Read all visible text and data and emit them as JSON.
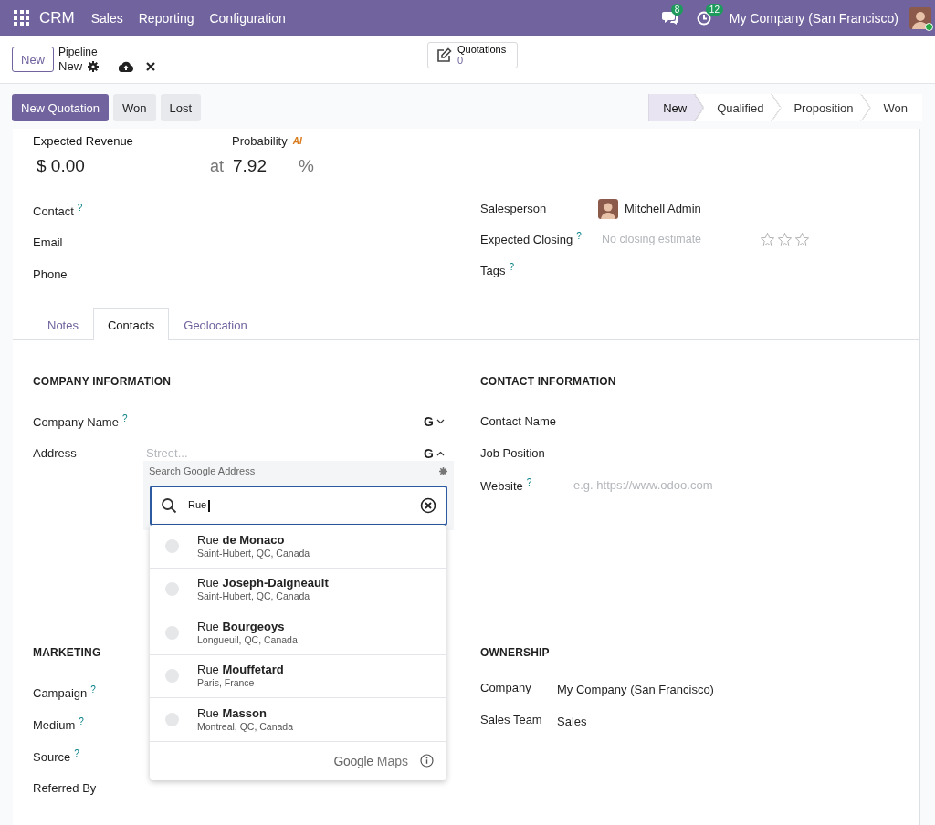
{
  "navbar": {
    "app": "CRM",
    "menus": [
      "Sales",
      "Reporting",
      "Configuration"
    ],
    "messages_count": "8",
    "activities_count": "12",
    "company": "My Company (San Francisco)"
  },
  "control_panel": {
    "new_button": "New",
    "breadcrumb": "Pipeline",
    "record": "New",
    "smart_button": {
      "label": "Quotations",
      "value": "0"
    }
  },
  "actions": [
    {
      "label": "New Quotation",
      "kind": "primary"
    },
    {
      "label": "Won",
      "kind": "secondary"
    },
    {
      "label": "Lost",
      "kind": "secondary"
    }
  ],
  "stages": [
    {
      "label": "New",
      "selected": true
    },
    {
      "label": "Qualified",
      "selected": false
    },
    {
      "label": "Proposition",
      "selected": false
    },
    {
      "label": "Won",
      "selected": false
    }
  ],
  "summary": {
    "revenue_label": "Expected Revenue",
    "revenue": "$ 0.00",
    "probability_label": "Probability",
    "ai_badge": "AI",
    "at": "at",
    "probability": "7.92",
    "percent": "%"
  },
  "left_fields": [
    {
      "label": "Contact",
      "help": "?"
    },
    {
      "label": "Email"
    },
    {
      "label": "Phone"
    }
  ],
  "right_fields": [
    {
      "label": "Salesperson",
      "kind": "user",
      "value": "Mitchell Admin"
    },
    {
      "label": "Expected Closing",
      "help": "?",
      "kind": "date",
      "placeholder": "No closing estimate",
      "stars": 0
    },
    {
      "label": "Tags",
      "help": "?",
      "kind": "plain"
    }
  ],
  "tabs": [
    {
      "label": "Notes",
      "selected": false
    },
    {
      "label": "Contacts",
      "selected": true
    },
    {
      "label": "Geolocation",
      "selected": false
    }
  ],
  "company_information": {
    "title": "COMPANY INFORMATION",
    "fields": [
      {
        "label": "Company Name",
        "help": "?",
        "kind": "google",
        "button": "G",
        "expanded": false
      },
      {
        "label": "Address",
        "kind": "google",
        "placeholder": "Street...",
        "button": "G",
        "expanded": true
      }
    ]
  },
  "address_search": {
    "title": "Search Google Address",
    "value": "Rue",
    "suggestions": [
      {
        "name": "Rue **de Monaco**",
        "place": "Saint-Hubert, QC, Canada"
      },
      {
        "name": "Rue **Joseph-Daigneault**",
        "place": "Saint-Hubert, QC, Canada"
      },
      {
        "name": "Rue **Bourgeoys**",
        "place": "Longueuil, QC, Canada"
      },
      {
        "name": "Rue **Mouffetard**",
        "place": "Paris, France"
      },
      {
        "name": "Rue **Masson**",
        "place": "Montreal, QC, Canada"
      }
    ],
    "footer_brand": "Google",
    "footer_product": "Maps"
  },
  "contact_information": {
    "title": "CONTACT INFORMATION",
    "fields": [
      {
        "label": "Contact Name"
      },
      {
        "label": "Job Position"
      },
      {
        "label": "Website",
        "help": "?",
        "placeholder": "e.g. https://www.odoo.com"
      }
    ]
  },
  "marketing": {
    "title": "MARKETING",
    "fields": [
      {
        "label": "Campaign",
        "help": "?"
      },
      {
        "label": "Medium",
        "help": "?"
      },
      {
        "label": "Source",
        "help": "?"
      },
      {
        "label": "Referred By"
      }
    ]
  },
  "ownership": {
    "title": "OWNERSHIP",
    "fields": [
      {
        "label": "Company",
        "value": "My Company (San Francisco)"
      },
      {
        "label": "Sales Team",
        "value": "Sales"
      }
    ]
  }
}
